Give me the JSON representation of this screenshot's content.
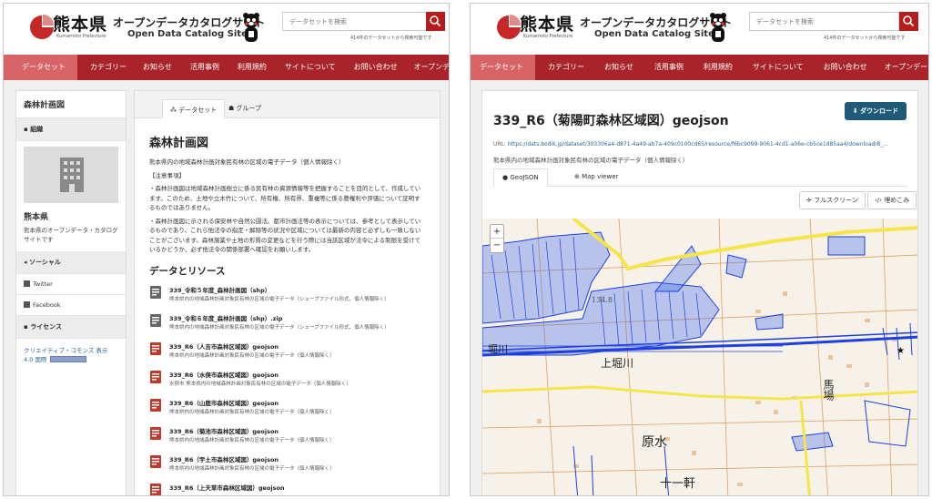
{
  "header": {
    "pref_name": "熊本県",
    "pref_en": "Kumamoto Prefecture",
    "site_title_ja": "オープンデータカタログサイト",
    "site_title_en": "Open Data Catalog Site",
    "search_placeholder": "データセットを検索",
    "dataset_count": "414件のデータセットから検索可能です"
  },
  "nav": [
    "データセット",
    "カテゴリー",
    "お知らせ",
    "活用事例",
    "利用規約",
    "サイトについて",
    "お問い合わせ",
    "オープンデータマップ"
  ],
  "left": {
    "sidebar": {
      "title": "森林計画図",
      "org_section": "組織",
      "org_name": "熊本県",
      "org_desc": "熊本県のオープンデータ・カタログサイトです",
      "social_section": "ソーシャル",
      "twitter": "Twitter",
      "facebook": "Facebook",
      "license_section": "ライセンス",
      "license_text": "クリエイティブ・コモンズ 表示 4.0 国際"
    },
    "tabs": [
      "データセット",
      "グループ"
    ],
    "title": "森林計画図",
    "lead": "熊本県内の地域森林計画対象民有林の区域の電子データ（個人情報除く）",
    "notice_head": "【注意事項】",
    "notice1": "・森林計画図は地域森林計画樹立に係る民有林の資源情報等を把握することを目的として、作成しています。このため、土地や立木竹について、所有権、所有界、重複等に係る謄権利や評価について証明するものではありません。",
    "notice2": "・森林計画図に示される保安林や自然公園法、都市計画法等の表示については、参考として表示しているものであり、これら他法令の指定・解除等の状況や区域については最新の内容と必ずしも一致しないことがございます。森林施業や土地の形質の変更などを行う際には当該区域が法令による制限を受けているかどうか、必ず他法令の関係部署へ確認をお願いします。",
    "resources_head": "データとリソース",
    "resources": [
      {
        "name": "339_令和５年度_森林計画図（shp）",
        "desc": "熊本県内の地域森林計画対象民有林の区域の電子データ（シェープファイル形式、個人情報除く）",
        "type": "shp"
      },
      {
        "name": "339_令和６年度_森林計画図（shp）.zip",
        "desc": "熊本県内の地域森林計画対象民有林の区域の電子データ（シェープファイル形式、個人情報除く）",
        "type": "shp"
      },
      {
        "name": "339_R6（人吉市森林区域図）geojson",
        "desc": "熊本県内の地域森林計画対象民有林の区域の電子データ（個人情報除く）",
        "type": "geo"
      },
      {
        "name": "339_R6（水俣市森林区域図）geojson",
        "desc": "水俣市 熊本県内の地域森林計画対象民有林の区域の電子データ（個人情報除く）",
        "type": "geo"
      },
      {
        "name": "339_R6（山鹿市森林区域図）geojson",
        "desc": "熊本県内の地域森林計画対象民有林の区域の電子データ（個人情報除く）",
        "type": "geo"
      },
      {
        "name": "339_R6（菊池市森林区域図）geojson",
        "desc": "熊本県内の地域森林計画対象民有林の区域の電子データ（個人情報除く）",
        "type": "geo"
      },
      {
        "name": "339_R6（宇土市森林区域図）geojson",
        "desc": "熊本県内の地域森林計画対象民有林の区域の電子データ（個人情報除く）",
        "type": "geo"
      },
      {
        "name": "339_R6（上天草市森林区域図）geojson",
        "desc": "",
        "type": "geo"
      }
    ]
  },
  "right": {
    "download": "ダウンロード",
    "title": "339_R6（菊陽町森林区域図）geojson",
    "url_label": "URL:",
    "url": "https://dats.bodik.jp/dataset/303306a4-d871-4a49-ab7a-409c0100cd65/resource/f6bc9099-9061-4cd1-a06e-cb5ce1d85aa4/download/8_...",
    "desc": "熊本県内の地域森林計画対象民有林の区域の電子データ（個人情報除く）",
    "tabs": [
      "GeoJSON",
      "Map viewer"
    ],
    "fullscreen": "フルスクリーン",
    "embed": "埋めこみ",
    "map_labels": [
      "上堀川",
      "原水",
      "十一軒",
      "馬場",
      "堀川",
      "134.8"
    ]
  },
  "colors": {
    "brand": "#a8242a",
    "nav_active": "#d86468",
    "download": "#1f5b79",
    "polygon": "#1e3fe0"
  }
}
